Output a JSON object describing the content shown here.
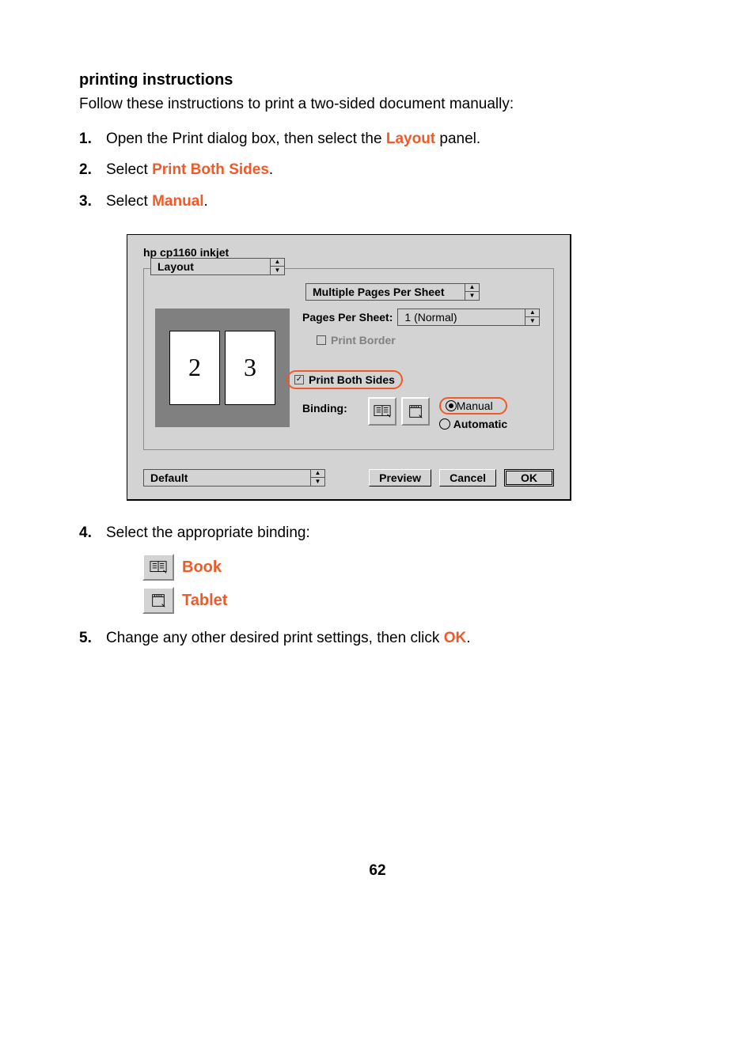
{
  "heading": "printing instructions",
  "intro": "Follow these instructions to print a two-sided document manually:",
  "steps": {
    "s1": {
      "num": "1.",
      "part1": "Open the Print dialog box, then select the ",
      "hl": "Layout",
      "part2": " panel."
    },
    "s2": {
      "num": "2.",
      "part1": "Select ",
      "hl": "Print Both Sides",
      "part2": "."
    },
    "s3": {
      "num": "3.",
      "part1": "Select ",
      "hl": "Manual",
      "part2": "."
    },
    "s4": {
      "num": "4.",
      "part1": "Select the appropriate binding:"
    },
    "s5": {
      "num": "5.",
      "part1": "Change any other desired print settings, then click ",
      "hl": "OK",
      "part2": "."
    }
  },
  "dialog": {
    "title": "hp cp1160 inkjet",
    "panel_select": "Layout",
    "multi_pages": "Multiple Pages Per Sheet",
    "pps_label": "Pages Per Sheet:",
    "pps_value": "1 (Normal)",
    "print_border": "Print Border",
    "print_both_sides": "Print Both Sides",
    "binding_label": "Binding:",
    "manual": "Manual",
    "automatic": "Automatic",
    "default": "Default",
    "preview": "Preview",
    "cancel": "Cancel",
    "ok": "OK",
    "page2": "2",
    "page3": "3"
  },
  "bindings": {
    "book": "Book",
    "tablet": "Tablet"
  },
  "page_number": "62"
}
